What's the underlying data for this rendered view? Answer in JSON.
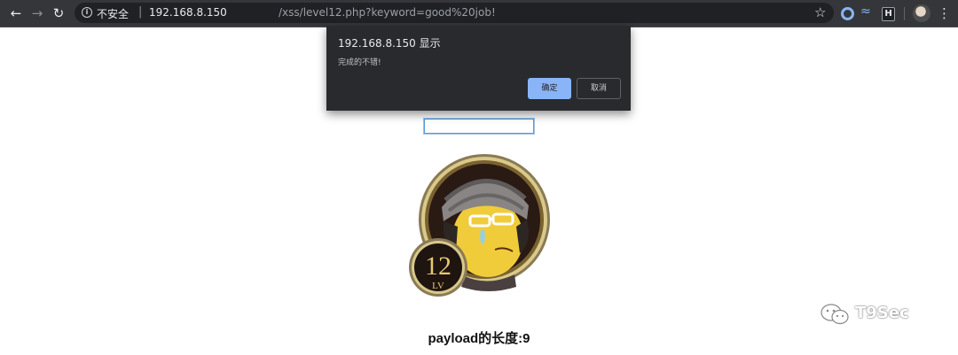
{
  "browser": {
    "back_icon": "arrow-left-icon",
    "forward_icon": "arrow-right-icon",
    "reload_icon": "reload-icon",
    "security_label": "不安全",
    "url_host": "192.168.8.150",
    "url_path": "/xss/level12.php?keyword=good%20job!",
    "bookmark_icon": "star-icon",
    "menu_icon": "more-vert-icon"
  },
  "dialog": {
    "title": "192.168.8.150 显示",
    "message": "完成的不错!",
    "ok_label": "确定",
    "cancel_label": "取消"
  },
  "page": {
    "keyword_value": "",
    "level_number": "12",
    "level_suffix": "LV",
    "payload_label": "payload的长度:9"
  },
  "watermark": {
    "text": "T9Sec",
    "icon": "wechat-icon"
  },
  "colors": {
    "chrome_bg": "#35363a",
    "omnibox_bg": "#202124",
    "dialog_bg": "#292a2d",
    "accent_blue": "#8ab4f8"
  }
}
